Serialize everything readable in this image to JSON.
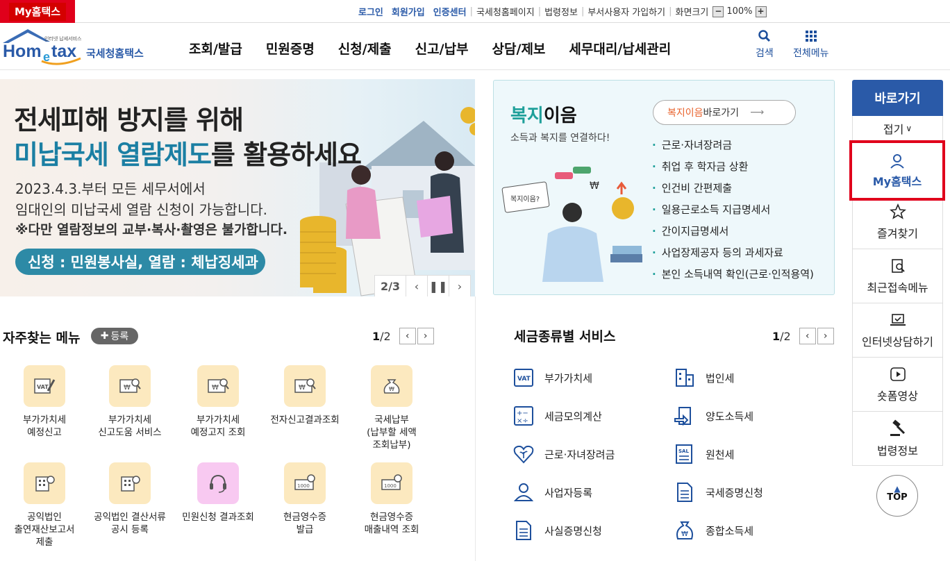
{
  "topbar": {
    "my_tab": "My홈택스",
    "links": [
      "로그인",
      "회원가입",
      "인증센터"
    ],
    "sub_links": [
      "국세청홈페이지",
      "법령정보",
      "부서사용자 가입하기",
      "화면크기"
    ],
    "zoom": "100%"
  },
  "header": {
    "logo_small": "인터넷 납세서비스",
    "logo_brand": "Hometax",
    "logo_kr": "국세청홈택스",
    "nav": [
      "조회/발급",
      "민원증명",
      "신청/제출",
      "신고/납부",
      "상담/제보",
      "세무대리/납세관리"
    ],
    "search": "검색",
    "all_menu": "전체메뉴"
  },
  "banner": {
    "line1": "전세피해 방지를 위해",
    "line2_a": "미납국세 열람제도",
    "line2_b": "를 활용하세요",
    "p1": "2023.4.3.부터 모든 세무서에서",
    "p2": "임대인의 미납국세 열람 신청이 가능합니다.",
    "p3": "※다만 열람정보의 교부·복사·촬영은 불가합니다.",
    "pill": "신청 : 민원봉사실, 열람 : 체납징세과",
    "page": "2/3"
  },
  "welfare": {
    "title_a": "복지",
    "title_b": "이음",
    "subtitle": "소득과 복지를 연결하다!",
    "go_a": "복지이음",
    "go_b": " 바로가기",
    "bubble": "복지이음?",
    "items": [
      "근로·자녀장려금",
      "취업 후 학자금 상환",
      "인건비 간편제출",
      "일용근로소득 지급명세서",
      "간이지급명세서",
      "사업장제공자 등의 과세자료",
      "본인 소득내역 확인(근로·인적용역)"
    ]
  },
  "right": {
    "head": "바로가기",
    "fold": "접기",
    "items": [
      "My홈택스",
      "즐겨찾기",
      "최근접속메뉴",
      "인터넷상담하기",
      "숏폼영상",
      "법령정보"
    ],
    "top": "TOP"
  },
  "favorites": {
    "title": "자주찾는 메뉴",
    "register": "등록",
    "page_cur": "1",
    "page_total": "/2",
    "items": [
      {
        "label": "부가가치세\n예정신고",
        "icon": "vat-pen-icon"
      },
      {
        "label": "부가가치세\n신고도움 서비스",
        "icon": "won-search-icon"
      },
      {
        "label": "부가가치세\n예정고지 조회",
        "icon": "won-search-icon"
      },
      {
        "label": "전자신고결과조회",
        "icon": "won-search-icon"
      },
      {
        "label": "국세납부\n(납부할 세액\n조회납부)",
        "icon": "money-bag-icon"
      },
      {
        "label": "공익법인\n출연재산보고서\n제출",
        "icon": "building-badge-icon"
      },
      {
        "label": "공익법인 결산서류\n공시 등록",
        "icon": "building-badge-icon"
      },
      {
        "label": "민원신청 결과조회",
        "icon": "headset-icon"
      },
      {
        "label": "현금영수증\n발급",
        "icon": "receipt-search-icon"
      },
      {
        "label": "현금영수증\n매출내역 조회",
        "icon": "receipt-search-icon"
      }
    ]
  },
  "taxes": {
    "title": "세금종류별 서비스",
    "page_cur": "1",
    "page_total": "/2",
    "items": [
      "부가가치세",
      "법인세",
      "세금모의계산",
      "양도소득세",
      "근로·자녀장려금",
      "원천세",
      "사업자등록",
      "국세증명신청",
      "사실증명신청",
      "종합소득세"
    ]
  },
  "colors": {
    "brand": "#2a5aa8",
    "highlight": "#e0001b",
    "teal": "#1fa09a"
  }
}
